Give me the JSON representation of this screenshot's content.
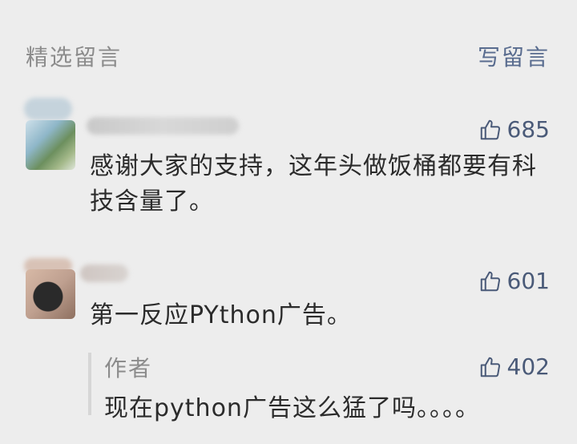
{
  "header": {
    "title": "精选留言",
    "write_label": "写留言"
  },
  "comments": [
    {
      "text": "感谢大家的支持，这年头做饭桶都要有科技含量了。",
      "likes": "685"
    },
    {
      "text": "第一反应PYthon广告。",
      "likes": "601",
      "reply": {
        "author": "作者",
        "text": "现在python广告这么猛了吗。。。。",
        "likes": "402"
      }
    }
  ],
  "icons": {
    "like": "thumbs-up-icon"
  },
  "colors": {
    "background": "#ededed",
    "link": "#596c8f",
    "like": "#4a5a78"
  }
}
